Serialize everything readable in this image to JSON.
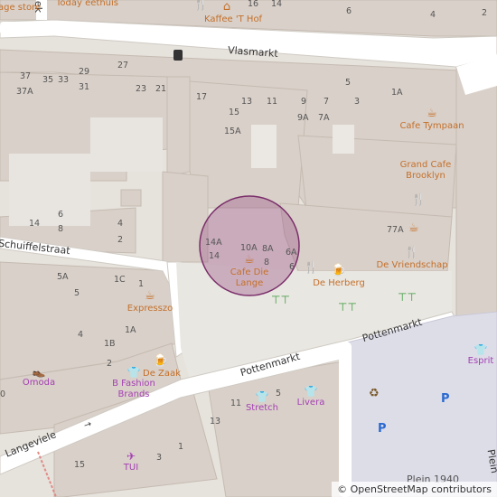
{
  "map": {
    "streets": {
      "vlasmarkt": "Vlasmarkt",
      "schuiffelstraat": "Schuiffelstraat",
      "pottenmarkt_1": "Pottenmarkt",
      "pottenmarkt_2": "Pottenmarkt",
      "langeviele": "Langeviele",
      "plein_1940": "Plein 1940",
      "plein_cut": "Plein",
      "top_cut": "ek"
    },
    "pois": {
      "cafe_die_lange": "Cafe Die Lange",
      "cafe_tympaan": "Cafe Tympaan",
      "grand_cafe_brooklyn": "Grand Cafe Brooklyn",
      "de_vriendschap": "De Vriendschap",
      "de_herberg": "De Herberg",
      "kaffee_t_hof": "Kaffee 'T Hof",
      "today_eethuis": "Today eethuis",
      "expresszo": "Expresszo",
      "de_zaak": "De Zaak",
      "age_store": "age store"
    },
    "shops": {
      "omoda": "Omoda",
      "b_fashion_brands": "B Fashion Brands",
      "stretch": "Stretch",
      "livera": "Livera",
      "esprit": "Esprit",
      "tui": "TUI"
    },
    "house_numbers": [
      "37",
      "35",
      "33",
      "29",
      "27",
      "23",
      "21",
      "17",
      "13",
      "11",
      "9",
      "5",
      "1A",
      "37A",
      "31",
      "15",
      "9A",
      "7A",
      "3",
      "15A",
      "7",
      "14",
      "6",
      "8",
      "4",
      "2",
      "14A",
      "10A",
      "8A",
      "6A",
      "14",
      "8",
      "6",
      "5A",
      "5",
      "1C",
      "1",
      "1A",
      "4",
      "1B",
      "2",
      "0",
      "11",
      "5",
      "13",
      "1",
      "3",
      "15",
      "16",
      "14",
      "6",
      "4",
      "2"
    ],
    "selected_address": "Cafe Die Lange",
    "icons": [
      "cafe-icon",
      "restaurant-icon",
      "bar-icon",
      "shoe-shop-icon",
      "clothes-shop-icon",
      "travel-agency-icon",
      "recycling-icon",
      "bicycle-parking-icon",
      "parking-icon",
      "picnic-table-icon",
      "atm-icon",
      "ice-cream-icon"
    ],
    "colors": {
      "building": "#d9d0c9",
      "building_outline": "#c5bbb2",
      "road": "#ffffff",
      "pedestrian": "#dddde8",
      "square": "#e9e7e2",
      "poi_brown": "#c4702a",
      "shop_purple": "#a43fb3",
      "marker_fill": "#9e5a8a",
      "marker_stroke": "#7a2e6a"
    }
  },
  "attribution": {
    "copyright": "© OpenStreetMap contributors"
  }
}
